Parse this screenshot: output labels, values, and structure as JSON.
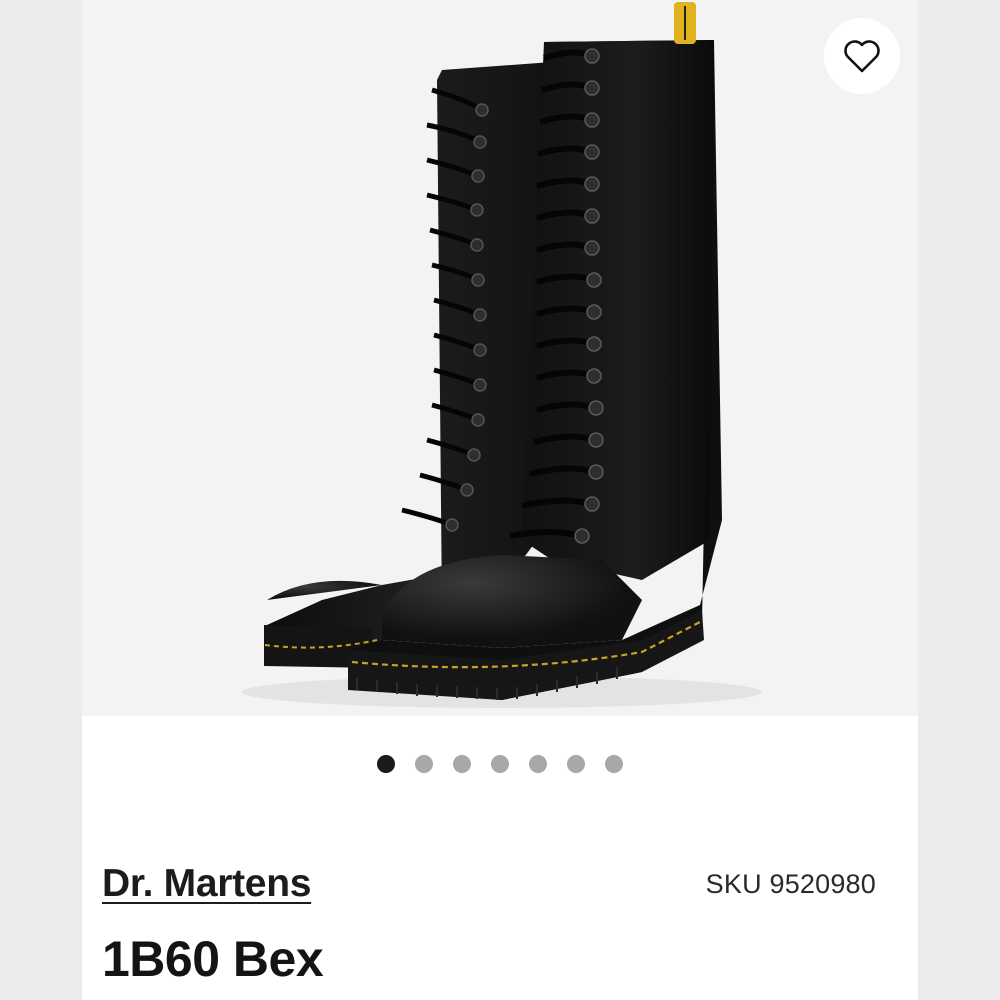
{
  "product": {
    "brand": "Dr. Martens",
    "sku": "SKU 9520980",
    "name": "1B60 Bex",
    "image_alt_icon": "boot-pair-image"
  },
  "favorite": {
    "icon": "heart-outline-icon"
  },
  "carousel": {
    "count": 7,
    "active_index": 0,
    "colors": {
      "active": "#1b1b1b",
      "inactive": "#a8a8a8"
    }
  },
  "colors": {
    "background": "#ffffff",
    "gallery_bg": "#f3f3f3",
    "text": "#1c1c1c"
  }
}
